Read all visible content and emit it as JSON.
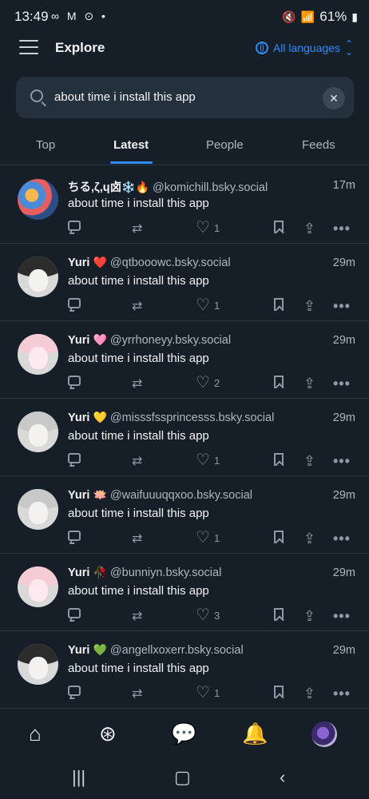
{
  "status_bar": {
    "time": "13:49",
    "left_icons": "∞ M ⊙ •",
    "battery": "61%"
  },
  "header": {
    "title": "Explore",
    "language_label": "All languages"
  },
  "search": {
    "query": "about time i install this app",
    "clear": "✕"
  },
  "tabs": [
    "Top",
    "Latest",
    "People",
    "Feeds"
  ],
  "posts": [
    {
      "name": "ちる,ζ,ɥ卤",
      "emoji": "❄️🔥",
      "handle": "@komichill.bsky.social",
      "time": "17m",
      "text": "about time i install this app",
      "likes": "1"
    },
    {
      "name": "Yuri",
      "emoji": "❤️",
      "handle": "@qtbooowc.bsky.social",
      "time": "29m",
      "text": "about time i install this app",
      "likes": "1"
    },
    {
      "name": "Yuri",
      "emoji": "🩷",
      "handle": "@yrrhoneyy.bsky.social",
      "time": "29m",
      "text": "about time i install this app",
      "likes": "2"
    },
    {
      "name": "Yuri",
      "emoji": "💛",
      "handle": "@misssfssprincesss.bsky.social",
      "time": "29m",
      "text": "about time i install this app",
      "likes": "1"
    },
    {
      "name": "Yuri",
      "emoji": "🪷",
      "handle": "@waifuuuqqxoo.bsky.social",
      "time": "29m",
      "text": "about time i install this app",
      "likes": "1"
    },
    {
      "name": "Yuri",
      "emoji": "🥀",
      "handle": "@bunniyn.bsky.social",
      "time": "29m",
      "text": "about time i install this app",
      "likes": "3"
    },
    {
      "name": "Yuri",
      "emoji": "💚",
      "handle": "@angellxoxerr.bsky.social",
      "time": "29m",
      "text": "about time i install this app",
      "likes": "1"
    }
  ],
  "colors": {
    "background": "#161e27",
    "accent": "#2f8cff",
    "muted": "#aeb7c1"
  },
  "icons": {
    "post_actions": [
      "reply-icon",
      "repost-icon",
      "like-icon",
      "bookmark-icon",
      "share-icon",
      "more-icon"
    ],
    "bottom_nav": [
      "home-icon",
      "search-icon",
      "chat-icon",
      "notifications-icon",
      "profile-avatar"
    ]
  }
}
